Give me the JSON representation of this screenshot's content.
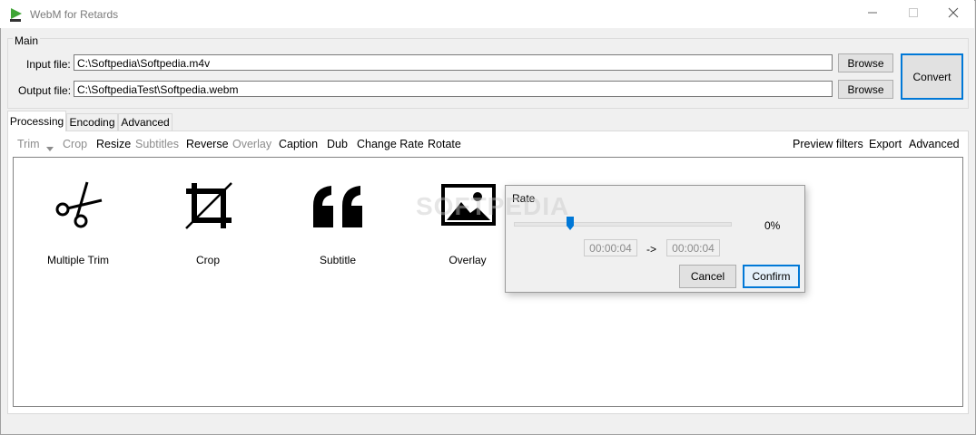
{
  "window": {
    "title": "WebM for Retards",
    "minimize_icon": "minimize-icon",
    "maximize_icon": "maximize-icon",
    "close_icon": "close-icon"
  },
  "main": {
    "group_label": "Main",
    "input_label": "Input file:",
    "input_value": "C:\\Softpedia\\Softpedia.m4v",
    "output_label": "Output file:",
    "output_value": "C:\\SoftpediaTest\\Softpedia.webm",
    "browse_label": "Browse",
    "convert_label": "Convert"
  },
  "tabs": [
    {
      "label": "Processing",
      "active": true
    },
    {
      "label": "Encoding",
      "active": false
    },
    {
      "label": "Advanced",
      "active": false
    }
  ],
  "toolbar": {
    "left": [
      {
        "label": "Trim",
        "enabled": false
      },
      {
        "label": "Crop",
        "enabled": false
      },
      {
        "label": "Resize",
        "enabled": true
      },
      {
        "label": "Subtitles",
        "enabled": false
      },
      {
        "label": "Reverse",
        "enabled": true
      },
      {
        "label": "Overlay",
        "enabled": false
      },
      {
        "label": "Caption",
        "enabled": true
      },
      {
        "label": "Dub",
        "enabled": true
      },
      {
        "label": "Change Rate",
        "enabled": true
      },
      {
        "label": "Rotate",
        "enabled": true
      }
    ],
    "right": [
      {
        "label": "Preview filters"
      },
      {
        "label": "Export"
      },
      {
        "label": "Advanced"
      }
    ]
  },
  "filters": [
    {
      "label": "Multiple Trim",
      "icon": "scissors-icon"
    },
    {
      "label": "Crop",
      "icon": "crop-icon"
    },
    {
      "label": "Subtitle",
      "icon": "quote-icon"
    },
    {
      "label": "Overlay",
      "icon": "image-icon"
    }
  ],
  "rate_dialog": {
    "title": "Rate",
    "percent": "0%",
    "from_time": "00:00:04",
    "arrow": "->",
    "to_time": "00:00:04",
    "cancel_label": "Cancel",
    "confirm_label": "Confirm"
  },
  "watermark": "SOFTPEDIA",
  "colors": {
    "accent": "#0078d7",
    "disabled_text": "#8c8c8c"
  }
}
